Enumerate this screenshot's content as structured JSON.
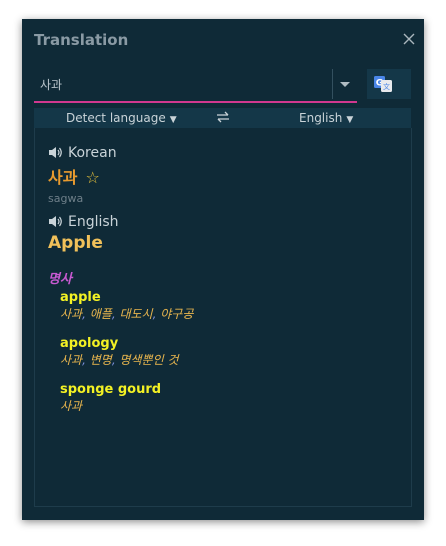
{
  "title": "Translation",
  "search": {
    "value": "사과"
  },
  "lang_bar": {
    "source": "Detect language",
    "target": "English"
  },
  "result": {
    "source_lang": "Korean",
    "source_word": "사과",
    "romanized": "sagwa",
    "target_lang": "English",
    "target_word": "Apple",
    "part_of_speech": "명사",
    "entries": [
      {
        "word": "apple",
        "defs": [
          "사과",
          "애플",
          "대도시",
          "야구공"
        ]
      },
      {
        "word": "apology",
        "defs": [
          "사과",
          "변명",
          "명색뿐인 것"
        ]
      },
      {
        "word": "sponge gourd",
        "defs": [
          "사과"
        ]
      }
    ]
  },
  "colors": {
    "panel_bg": "#0f2a37",
    "accent": "#d1388f",
    "source_word": "#e89b2f",
    "target_word": "#f1c15a",
    "pos": "#c85ad2",
    "entry_word": "#f3f124",
    "entry_defs": "#e9b64e"
  },
  "icons": [
    "close-icon",
    "chevron-down-icon",
    "google-translate-icon",
    "swap-icon",
    "speaker-icon",
    "star-icon"
  ]
}
